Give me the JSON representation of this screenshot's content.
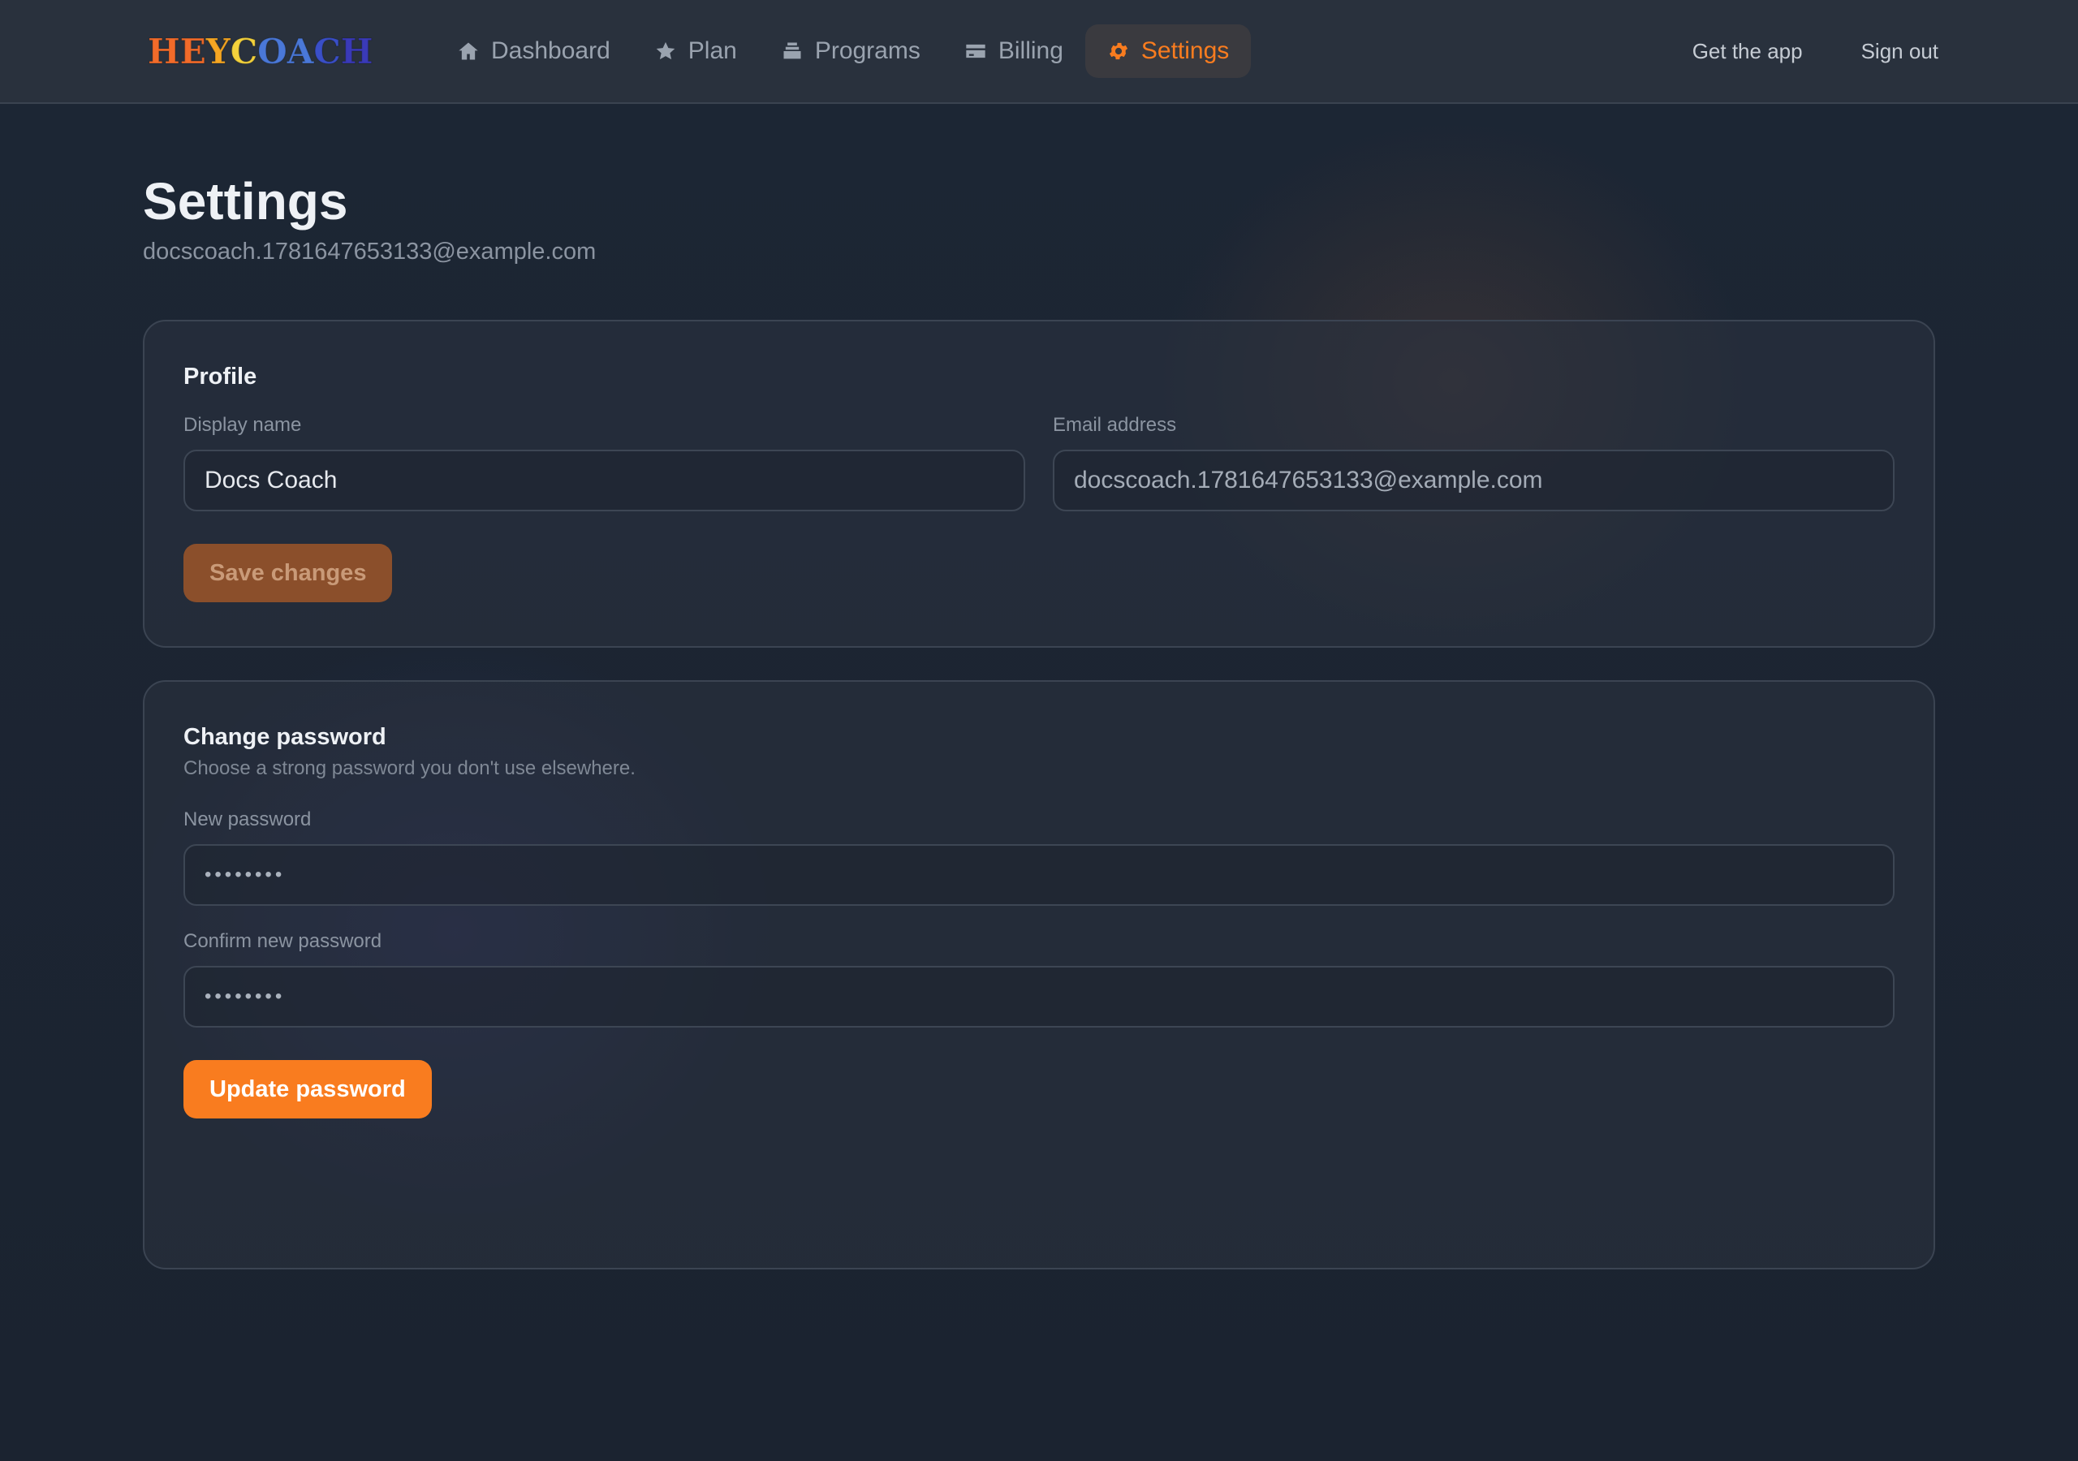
{
  "brand": {
    "letters": [
      {
        "char": "H",
        "color": "#f26b2a"
      },
      {
        "char": "E",
        "color": "#f26b2a"
      },
      {
        "char": "Y",
        "color": "#f5a623"
      },
      {
        "char": "C",
        "color": "#f4d23c"
      },
      {
        "char": "O",
        "color": "#4a78d8"
      },
      {
        "char": "A",
        "color": "#4a78d8"
      },
      {
        "char": "C",
        "color": "#3a4fc8"
      },
      {
        "char": "H",
        "color": "#3a3ab8"
      }
    ]
  },
  "nav": {
    "items": [
      {
        "label": "Dashboard",
        "icon": "home-icon",
        "active": false
      },
      {
        "label": "Plan",
        "icon": "star-icon",
        "active": false
      },
      {
        "label": "Programs",
        "icon": "stack-icon",
        "active": false
      },
      {
        "label": "Billing",
        "icon": "card-icon",
        "active": false
      },
      {
        "label": "Settings",
        "icon": "gear-icon",
        "active": true
      }
    ],
    "get_app": "Get the app",
    "sign_out": "Sign out"
  },
  "page": {
    "title": "Settings",
    "subtitle": "docscoach.1781647653133@example.com"
  },
  "profile": {
    "title": "Profile",
    "display_name_label": "Display name",
    "display_name_value": "Docs Coach",
    "email_label": "Email address",
    "email_value": "docscoach.1781647653133@example.com",
    "save_label": "Save changes"
  },
  "password": {
    "title": "Change password",
    "description": "Choose a strong password you don't use elsewhere.",
    "new_label": "New password",
    "new_value": "••••••••",
    "confirm_label": "Confirm new password",
    "confirm_value": "••••••••",
    "update_label": "Update password"
  },
  "colors": {
    "accent": "#f97c1f",
    "background": "#1b2330",
    "navbar": "#29313d"
  }
}
